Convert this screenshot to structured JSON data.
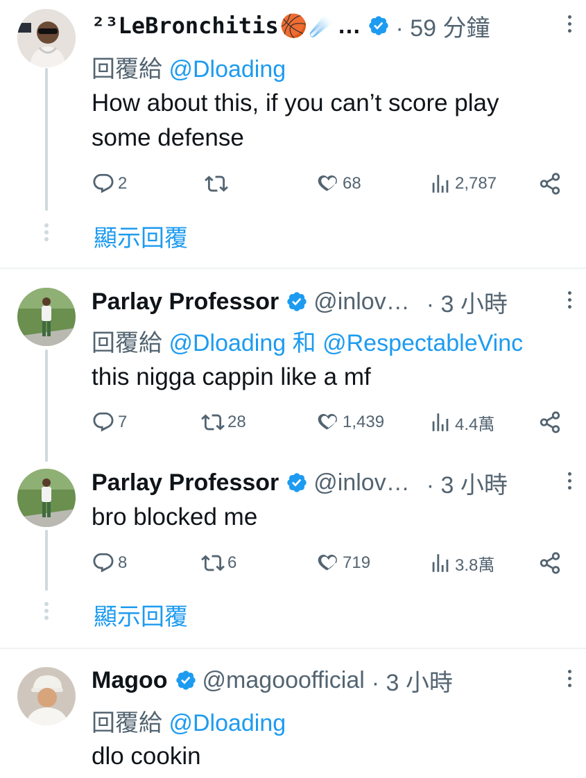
{
  "tweets": [
    {
      "name": "²³LeBronchitis🏀☄️ …",
      "name_text": "²³LeBronchitis",
      "name_emoji": "🏀",
      "name_emoji2": "☄️",
      "name_ellipsis": "…",
      "handle": "",
      "time": "· 59 分鐘",
      "reply_prefix": "回覆給",
      "mentions": [
        "@Dloading"
      ],
      "text": "How about this, if you can’t score play some defense",
      "text_lines": [
        "How about this, if you can’t score play",
        "some defense"
      ],
      "replies": "2",
      "retweets": "",
      "likes": "68",
      "views": "2,787"
    },
    {
      "name": "Parlay Professor",
      "handle": "@inlov…",
      "time": "· 3 小時",
      "reply_prefix": "回覆給",
      "mentions": [
        "@Dloading",
        "@RespectableVinc"
      ],
      "joiner": "和",
      "text": "this nigga cappin like a mf",
      "replies": "7",
      "retweets": "28",
      "likes": "1,439",
      "views": "4.4萬"
    },
    {
      "name": "Parlay Professor",
      "handle": "@inlov…",
      "time": "· 3 小時",
      "text": "bro blocked me",
      "replies": "8",
      "retweets": "6",
      "likes": "719",
      "views": "3.8萬"
    },
    {
      "name": "Magoo",
      "handle": "@magooofficial",
      "time": "· 3 小時",
      "reply_prefix": "回覆給",
      "mentions": [
        "@Dloading"
      ],
      "text": "dlo cookin"
    }
  ],
  "show_replies_label": "顯示回覆",
  "icons": {
    "verified": "verified-badge-icon",
    "reply": "reply-bubble-icon",
    "retweet": "retweet-icon",
    "like": "heart-icon",
    "views": "views-bar-chart-icon",
    "share": "share-icon",
    "more": "more-vertical-icon"
  },
  "colors": {
    "accent": "#1d9bf0",
    "muted": "#536471",
    "text": "#0f1419",
    "line": "#cfd9de"
  }
}
